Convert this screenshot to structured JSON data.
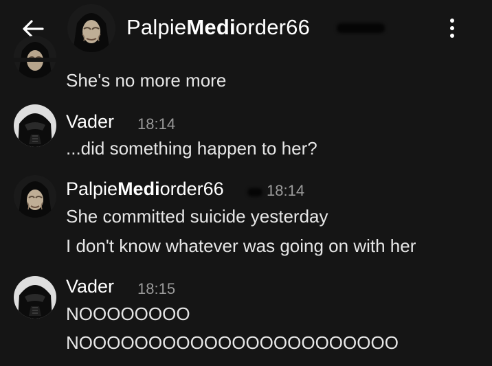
{
  "header": {
    "back_icon": "arrow-left-icon",
    "title_part1": "Palpie",
    "title_part2": "Medi",
    "title_part3": "order66",
    "menu_icon": "more-vertical-icon"
  },
  "messages": [
    {
      "text": "She's no more more"
    },
    {
      "author": "Vader",
      "time": "18:14",
      "lines": [
        "...did something happen to her?"
      ]
    },
    {
      "author_part1": "Palpie",
      "author_part2": "Medi",
      "author_part3": "order66",
      "time": "18:14",
      "lines": [
        "She committed suicide yesterday",
        "I don't know whatever was going on with her"
      ]
    },
    {
      "author": "Vader",
      "time": "18:15",
      "lines": [
        "NOOOOOOOO",
        "NOOOOOOOOOOOOOOOOOOOOOOO"
      ]
    }
  ],
  "colors": {
    "background": "#151515",
    "text": "#e6e6e6",
    "timestamp": "#9a9a9a",
    "title": "#ffffff"
  }
}
